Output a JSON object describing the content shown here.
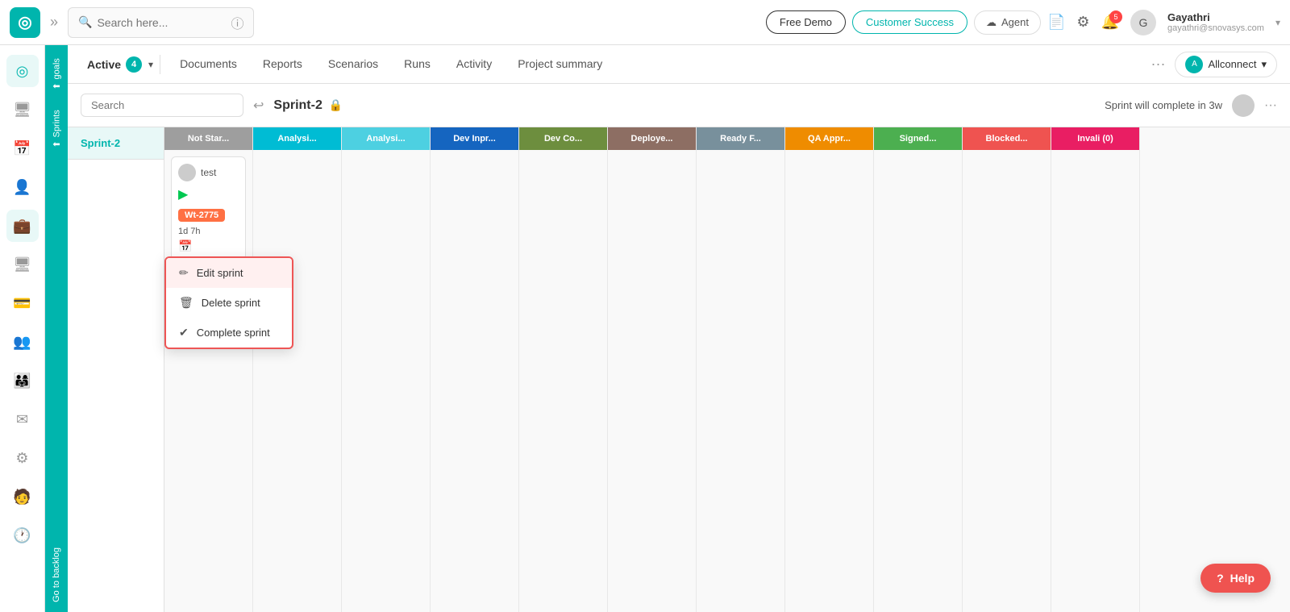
{
  "navbar": {
    "logo_symbol": "◎",
    "more_icon": "»",
    "search_placeholder": "Search here...",
    "info_icon": "ⓘ",
    "demo_btn": "Free Demo",
    "customer_success_btn": "Customer Success",
    "agent_icon": "☁",
    "agent_label": "Agent",
    "doc_icon": "📄",
    "settings_icon": "⚙",
    "notification_count": "5",
    "user_name": "Gayathri",
    "user_email": "gayathri@snovasys.com",
    "avatar_initial": "G",
    "chevron": "▾"
  },
  "sidebar": {
    "items": [
      {
        "name": "home-icon",
        "symbol": "◎",
        "active": true
      },
      {
        "name": "tv-icon",
        "symbol": "🖥",
        "active": false
      },
      {
        "name": "calendar-icon",
        "symbol": "📅",
        "active": false
      },
      {
        "name": "user-icon",
        "symbol": "👤",
        "active": false
      },
      {
        "name": "briefcase-icon",
        "symbol": "💼",
        "active": true
      },
      {
        "name": "monitor-icon",
        "symbol": "🖥",
        "active": false
      },
      {
        "name": "card-icon",
        "symbol": "💳",
        "active": false
      },
      {
        "name": "people-icon",
        "symbol": "👥",
        "active": false
      },
      {
        "name": "team-icon",
        "symbol": "👨‍👩‍👧",
        "active": false
      },
      {
        "name": "mail-icon",
        "symbol": "✉",
        "active": false
      },
      {
        "name": "gear-icon",
        "symbol": "⚙",
        "active": false
      },
      {
        "name": "person-icon",
        "symbol": "🧑",
        "active": false
      },
      {
        "name": "clock-icon",
        "symbol": "🕐",
        "active": false
      }
    ]
  },
  "sub_sidebar": {
    "goals_label": "goals",
    "sprints_label": "Sprints",
    "backlog_label": "Go to backlog"
  },
  "secondary_nav": {
    "active_label": "Active",
    "active_count": "4",
    "items": [
      "Documents",
      "Reports",
      "Scenarios",
      "Runs",
      "Activity",
      "Project summary"
    ],
    "allconnect_label": "Allconnect",
    "chevron": "▾"
  },
  "sprint_header": {
    "search_placeholder": "Search",
    "sprint_name": "Sprint-2",
    "lock_icon": "🔒",
    "complete_text": "Sprint will complete in 3w",
    "more_icon": "···"
  },
  "board": {
    "sprints": [
      {
        "name": "Sprint-2",
        "selected": true
      }
    ],
    "columns": [
      {
        "label": "Not Star...",
        "class": "col-not-started"
      },
      {
        "label": "Analysi...",
        "class": "col-analysis1"
      },
      {
        "label": "Analysi...",
        "class": "col-analysis2"
      },
      {
        "label": "Dev Inpr...",
        "class": "col-dev-inprogress"
      },
      {
        "label": "Dev Co...",
        "class": "col-dev-complete"
      },
      {
        "label": "Deploye...",
        "class": "col-deployed"
      },
      {
        "label": "Ready F...",
        "class": "col-ready"
      },
      {
        "label": "QA Appr...",
        "class": "col-qa-approved"
      },
      {
        "label": "Signed...",
        "class": "col-signed"
      },
      {
        "label": "Blocked...",
        "class": "col-blocked"
      },
      {
        "label": "Invali (0)",
        "class": "col-invalid"
      }
    ],
    "task": {
      "assignee_name": "test",
      "play_icon": "▶",
      "id_badge": "Wt-2775",
      "time": "1d 7h",
      "calendar_icon": "📅"
    }
  },
  "context_menu": {
    "items": [
      {
        "label": "Edit sprint",
        "icon": "✏",
        "highlighted": true
      },
      {
        "label": "Delete sprint",
        "icon": "🗑",
        "highlighted": false
      },
      {
        "label": "Complete sprint",
        "icon": "✔",
        "highlighted": false
      }
    ]
  },
  "help": {
    "icon": "?",
    "label": "Help"
  }
}
